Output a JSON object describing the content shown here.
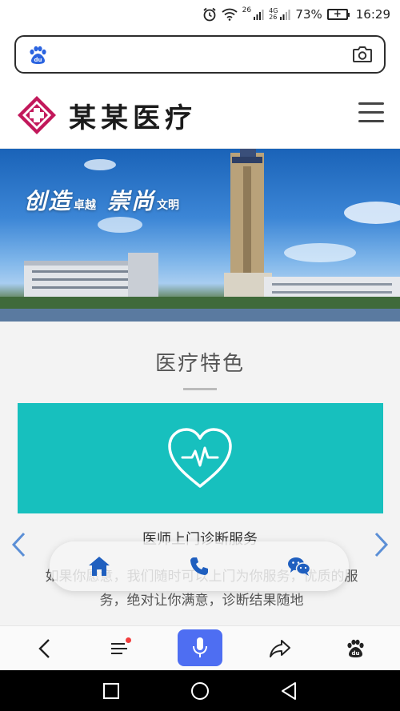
{
  "status_bar": {
    "network_top": "26",
    "network_bottom": "4G",
    "network_bottom2": "26",
    "battery": "73%",
    "time": "16:29"
  },
  "search": {
    "placeholder": "",
    "value": ""
  },
  "site": {
    "title": "某某医疗"
  },
  "banner": {
    "slogan_1_big": "创造",
    "slogan_1_small": "卓越",
    "slogan_2_big": "崇尚",
    "slogan_2_small": "文明"
  },
  "section": {
    "title": "医疗特色",
    "feature_title": "医师上门诊断服务",
    "feature_desc": "如果你愿意，我们随时可以上门为你服务，优质的服务，绝对让你满意，诊断结果随地"
  },
  "contact_bar": {
    "items": [
      "home-icon",
      "phone-icon",
      "wechat-icon"
    ]
  },
  "browser_bar": {
    "items": [
      "back-icon",
      "menu-icon",
      "mic-icon",
      "share-icon",
      "baidu-paw-icon"
    ]
  },
  "colors": {
    "accent": "#17c0be",
    "brand_blue": "#1f5fbf",
    "mic_blue": "#4e6ef2",
    "logo_magenta": "#c2185b"
  }
}
